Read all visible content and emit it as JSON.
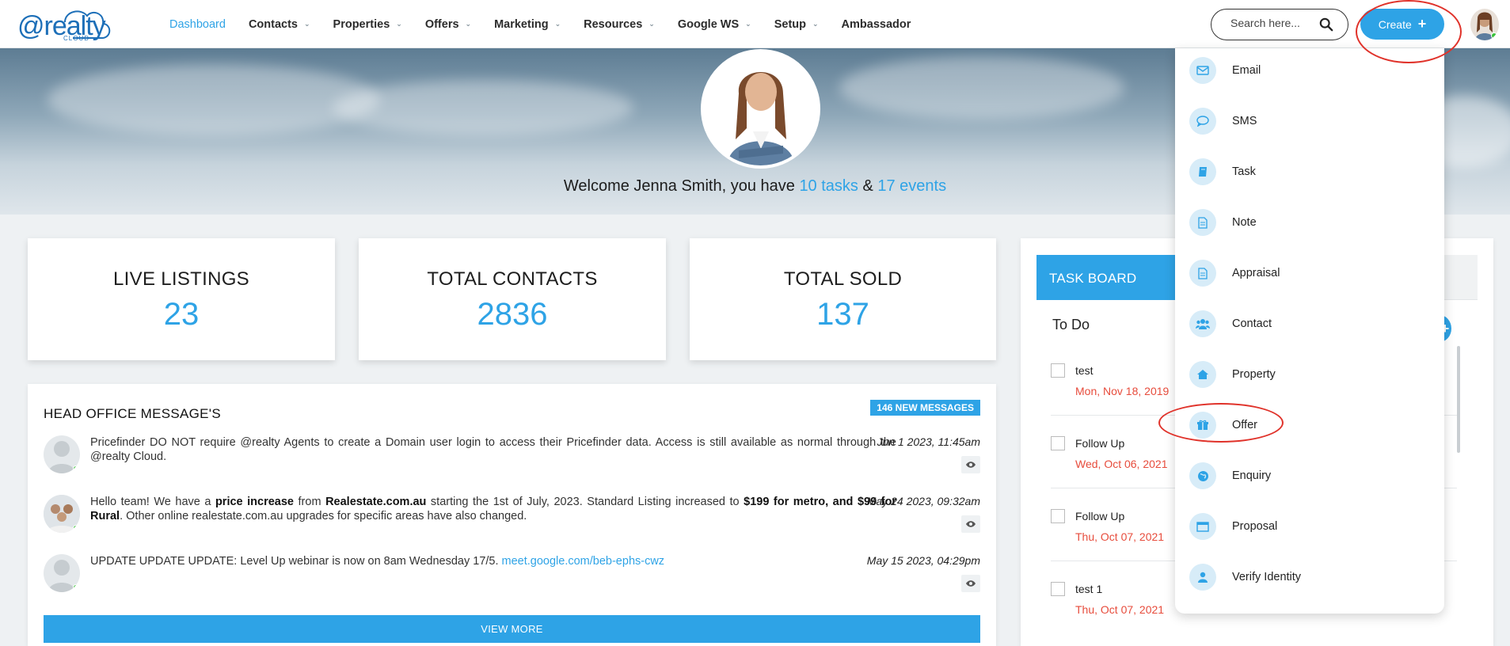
{
  "brand": {
    "name": "@realty",
    "sub": "CLOUD"
  },
  "nav": {
    "items": [
      {
        "label": "Dashboard",
        "active": true,
        "dropdown": false
      },
      {
        "label": "Contacts",
        "dropdown": true
      },
      {
        "label": "Properties",
        "dropdown": true
      },
      {
        "label": "Offers",
        "dropdown": true
      },
      {
        "label": "Marketing",
        "dropdown": true
      },
      {
        "label": "Resources",
        "dropdown": true
      },
      {
        "label": "Google WS",
        "dropdown": true
      },
      {
        "label": "Setup",
        "dropdown": true
      },
      {
        "label": "Ambassador",
        "dropdown": false
      }
    ],
    "search_placeholder": "Search here...",
    "create_label": "Create"
  },
  "hero": {
    "welcome_prefix": "Welcome Jenna Smith, you have ",
    "tasks": "10 tasks",
    "amp": " & ",
    "events": "17 events"
  },
  "stats": [
    {
      "label": "LIVE LISTINGS",
      "value": "23"
    },
    {
      "label": "TOTAL CONTACTS",
      "value": "2836"
    },
    {
      "label": "TOTAL SOLD",
      "value": "137"
    }
  ],
  "messages": {
    "title": "HEAD OFFICE MESSAGE'S",
    "badge": "146 NEW MESSAGES",
    "view_more": "VIEW MORE",
    "items": [
      {
        "text": "Pricefinder DO NOT require @realty Agents to create a Domain user login to access their Pricefinder data. Access is still available as normal through the @realty Cloud.",
        "date": "Jun 1 2023, 11:45am"
      },
      {
        "parts": [
          "Hello team! We have a ",
          "price increase",
          " from ",
          "Realestate.com.au",
          " starting the 1st of July, 2023. Standard Listing increased to ",
          "$199 for metro, and $99 for Rural",
          ". Other online realestate.com.au upgrades for specific areas have also changed."
        ],
        "date": "May 24 2023, 09:32am"
      },
      {
        "text": "UPDATE UPDATE UPDATE: Level Up webinar is now on 8am Wednesday 17/5. ",
        "link": "meet.google.com/beb-ephs-cwz",
        "date": "May 15 2023, 04:29pm"
      }
    ]
  },
  "taskboard": {
    "tab": "TASK BOARD",
    "column": "To Do",
    "tasks": [
      {
        "name": "test",
        "due": "Mon, Nov 18, 2019"
      },
      {
        "name": "Follow Up",
        "due": "Wed, Oct 06, 2021"
      },
      {
        "name": "Follow Up",
        "due": "Thu, Oct 07, 2021"
      },
      {
        "name": "test 1",
        "due": "Thu, Oct 07, 2021"
      }
    ]
  },
  "create_menu": {
    "items": [
      {
        "label": "Email",
        "icon": "envelope-icon"
      },
      {
        "label": "SMS",
        "icon": "chat-bubble-icon"
      },
      {
        "label": "Task",
        "icon": "book-icon"
      },
      {
        "label": "Note",
        "icon": "document-icon"
      },
      {
        "label": "Appraisal",
        "icon": "document-icon"
      },
      {
        "label": "Contact",
        "icon": "users-icon"
      },
      {
        "label": "Property",
        "icon": "home-icon"
      },
      {
        "label": "Offer",
        "icon": "gift-icon"
      },
      {
        "label": "Enquiry",
        "icon": "globe-icon"
      },
      {
        "label": "Proposal",
        "icon": "browser-icon"
      },
      {
        "label": "Verify Identity",
        "icon": "user-icon"
      }
    ]
  },
  "colors": {
    "accent": "#2ea3e6",
    "due": "#e74c3c",
    "annotation": "#e0322a",
    "online": "#3bc13b"
  }
}
